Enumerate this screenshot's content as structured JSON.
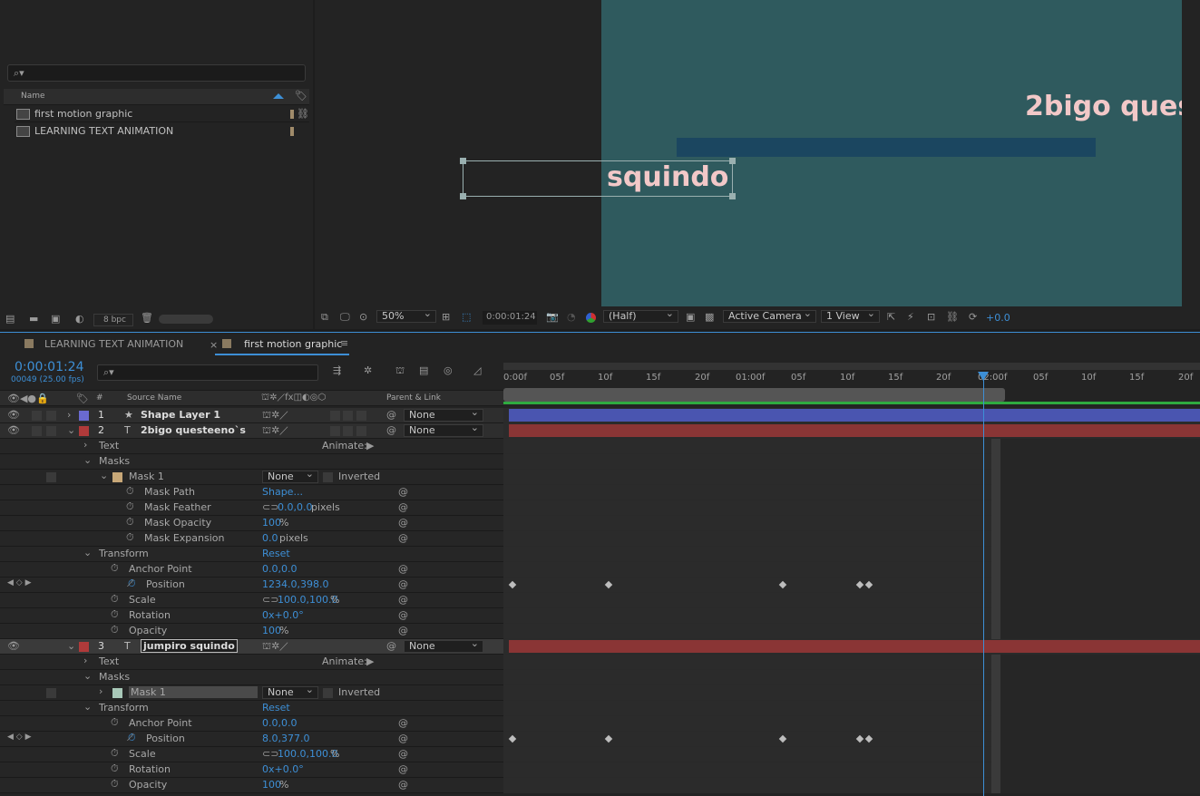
{
  "project": {
    "search_placeholder": "",
    "column_name": "Name",
    "items": [
      {
        "label": "first motion graphic",
        "type": "composition"
      },
      {
        "label": "LEARNING TEXT ANIMATION",
        "type": "composition"
      }
    ],
    "bpc": "8 bpc"
  },
  "viewer": {
    "canvas_color": "#2f5a5e",
    "text1": "2bigo ques",
    "text2": "squindo",
    "zoom": "50%",
    "timecode": "0:00:01:24",
    "resolution": "(Half)",
    "camera": "Active Camera",
    "views": "1 View",
    "exposure": "+0.0"
  },
  "tabs": [
    {
      "label": "LEARNING TEXT ANIMATION"
    },
    {
      "label": "first motion graphic"
    }
  ],
  "timeline": {
    "current_time": "0:00:01:24",
    "frame_info": "00049 (25.00 fps)",
    "col_num": "#",
    "col_source": "Source Name",
    "col_parent": "Parent & Link",
    "ruler": [
      "0:00f",
      "05f",
      "10f",
      "15f",
      "20f",
      "01:00f",
      "05f",
      "10f",
      "15f",
      "20f",
      "02:00f",
      "05f",
      "10f",
      "15f",
      "20f"
    ],
    "layers": [
      {
        "num": "1",
        "name": "Shape Layer 1",
        "parent": "None",
        "color": "#6a6ad0",
        "bar": "#4a55b0"
      },
      {
        "num": "2",
        "name": "2bigo questeeno`s",
        "parent": "None",
        "color": "#b03a3a",
        "bar": "#8a3535"
      },
      {
        "num": "3",
        "name": "jumpiro squindo",
        "parent": "None",
        "color": "#b03a3a",
        "bar": "#8a3535"
      }
    ],
    "animate_label": "Animate:",
    "text_label": "Text",
    "masks_label": "Masks",
    "mask_name": "Mask 1",
    "mask_mode": "None",
    "inverted_label": "Inverted",
    "mask_path": "Mask Path",
    "mask_path_val": "Shape...",
    "mask_feather": "Mask Feather",
    "mask_feather_val": "0.0,0.0",
    "pixels": "pixels",
    "mask_opacity": "Mask Opacity",
    "mask_opacity_val": "100",
    "mask_expansion": "Mask Expansion",
    "mask_expansion_val": "0.0",
    "transform_label": "Transform",
    "reset_label": "Reset",
    "anchor_label": "Anchor Point",
    "anchor_val": "0.0,0.0",
    "position_label": "Position",
    "position_val_2": "1234.0,398.0",
    "position_val_3": "8.0,377.0",
    "scale_label": "Scale",
    "scale_val": "100.0,100.0",
    "percent": "%",
    "rotation_label": "Rotation",
    "rotation_val": "0x+0.0°",
    "opacity_label": "Opacity",
    "opacity_val": "100"
  }
}
